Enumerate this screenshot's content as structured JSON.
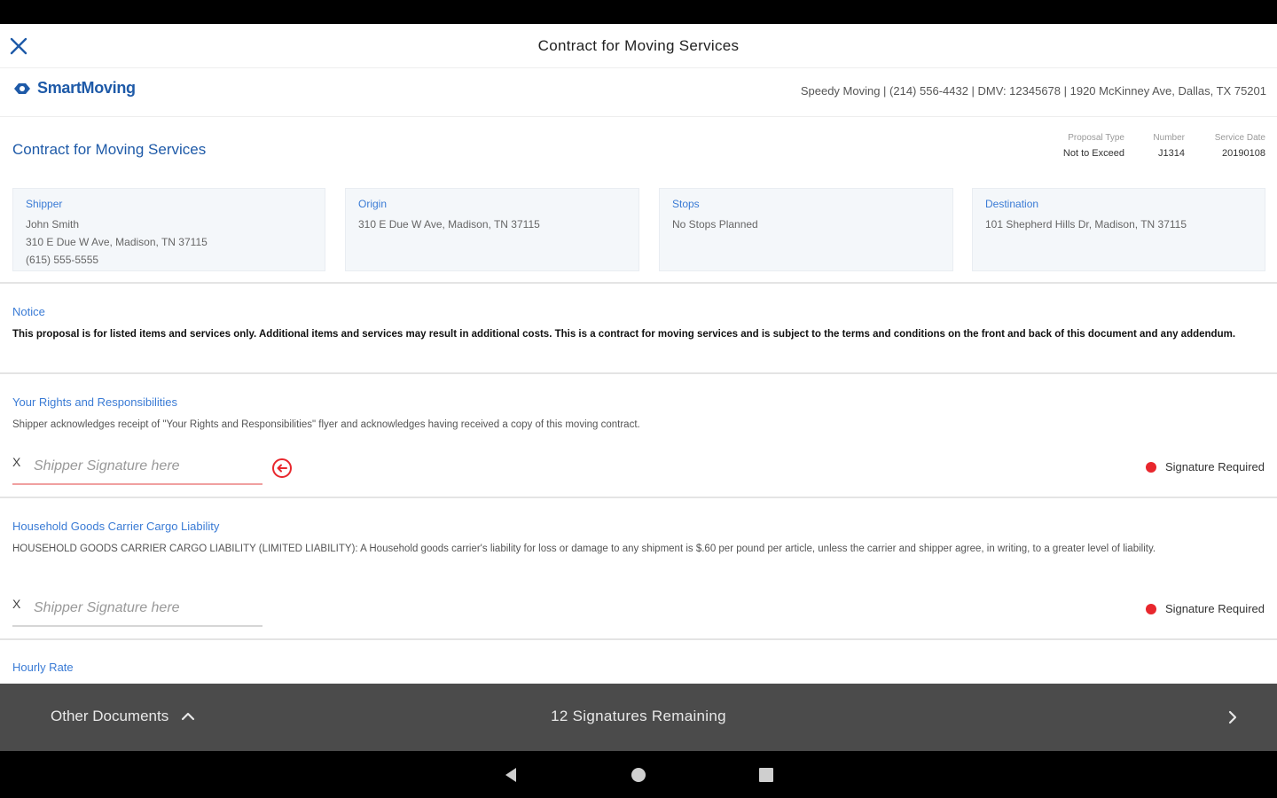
{
  "app": {
    "title": "Contract for Moving Services"
  },
  "brand": {
    "logo_text": "SmartMoving",
    "company_info": "Speedy Moving | (214) 556-4432 | DMV: 12345678 | 1920 McKinney Ave, Dallas, TX 75201"
  },
  "contract": {
    "title": "Contract for Moving Services",
    "meta": [
      {
        "label": "Proposal Type",
        "value": "Not to Exceed"
      },
      {
        "label": "Number",
        "value": "J1314"
      },
      {
        "label": "Service Date",
        "value": "20190108"
      }
    ],
    "cards": [
      {
        "label": "Shipper",
        "lines": [
          "John Smith",
          "310 E Due W Ave, Madison, TN 37115",
          "(615) 555-5555"
        ]
      },
      {
        "label": "Origin",
        "lines": [
          "310 E Due W Ave, Madison, TN 37115"
        ]
      },
      {
        "label": "Stops",
        "lines": [
          "No Stops Planned"
        ]
      },
      {
        "label": "Destination",
        "lines": [
          "101 Shepherd Hills Dr, Madison, TN 37115"
        ]
      }
    ]
  },
  "notice": {
    "label": "Notice",
    "text": "This proposal is for listed items and services only. Additional items and services may result in additional costs. This is a contract for moving services and is subject to the terms and conditions on the front and back of this document and any addendum."
  },
  "rights": {
    "label": "Your Rights and Responsibilities",
    "text": "Shipper acknowledges receipt of \"Your Rights and Responsibilities\" flyer and acknowledges having received a copy of this moving contract.",
    "sig_x": "X",
    "sig_placeholder": "Shipper Signature here",
    "required_text": "Signature Required"
  },
  "liability": {
    "label": "Household Goods Carrier Cargo Liability",
    "text": "HOUSEHOLD GOODS CARRIER CARGO LIABILITY (LIMITED LIABILITY): A Household goods carrier's liability for loss or damage to any shipment is $.60 per pound per article, unless the carrier and shipper agree, in writing, to a greater level of liability.",
    "sig_x": "X",
    "sig_placeholder": "Shipper Signature here",
    "required_text": "Signature Required"
  },
  "hourly": {
    "label": "Hourly Rate"
  },
  "footer": {
    "other_documents": "Other Documents",
    "remaining": "12 Signatures Remaining"
  },
  "colors": {
    "accent": "#1e5aa8",
    "link": "#3a7bd5",
    "required": "#e8272d",
    "bottom_bar": "#4b4b4b"
  },
  "icons": {
    "close": "close-icon",
    "logo": "smartmoving-logo-icon",
    "arrow": "arrow-left-circle-icon",
    "chevron_up": "chevron-up-icon",
    "chevron_right": "chevron-right-icon"
  }
}
